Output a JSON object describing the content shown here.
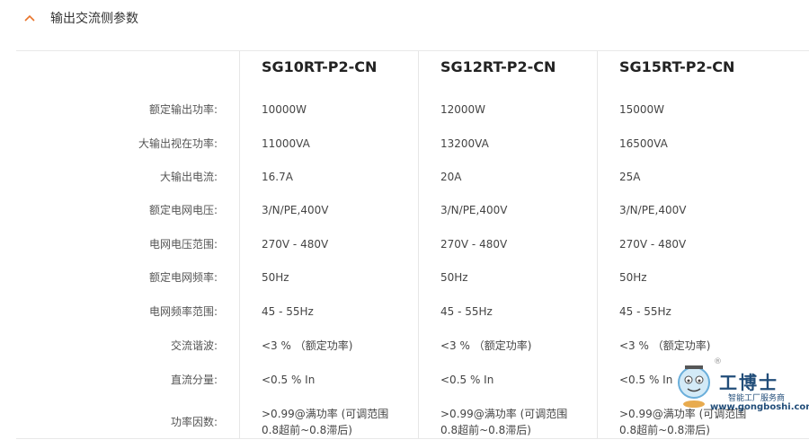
{
  "section": {
    "title": "输出交流侧参数",
    "toggle_icon": "chevron-up-icon",
    "accent": "#e8732a"
  },
  "table": {
    "models": [
      "SG10RT-P2-CN",
      "SG12RT-P2-CN",
      "SG15RT-P2-CN"
    ],
    "rows": [
      {
        "label": "额定输出功率:",
        "values": [
          "10000W",
          "12000W",
          "15000W"
        ]
      },
      {
        "label": "大输出视在功率:",
        "values": [
          "11000VA",
          "13200VA",
          "16500VA"
        ]
      },
      {
        "label": "大输出电流:",
        "values": [
          "16.7A",
          "20A",
          "25A"
        ]
      },
      {
        "label": "额定电网电压:",
        "values": [
          "3/N/PE,400V",
          "3/N/PE,400V",
          "3/N/PE,400V"
        ]
      },
      {
        "label": "电网电压范围:",
        "values": [
          "270V - 480V",
          "270V - 480V",
          "270V - 480V"
        ]
      },
      {
        "label": "额定电网频率:",
        "values": [
          "50Hz",
          "50Hz",
          "50Hz"
        ]
      },
      {
        "label": "电网频率范围:",
        "values": [
          "45 - 55Hz",
          "45 - 55Hz",
          "45 - 55Hz"
        ]
      },
      {
        "label": "交流谐波:",
        "values": [
          "<3 % （额定功率)",
          "<3 % （额定功率)",
          "<3 % （额定功率)"
        ]
      },
      {
        "label": "直流分量:",
        "values": [
          "<0.5 % In",
          "<0.5 % In",
          "<0.5 % In"
        ]
      },
      {
        "label": "功率因数:",
        "values": [
          ">0.99@满功率 (可调范围\n0.8超前~0.8滞后)",
          ">0.99@满功率 (可调范围\n0.8超前~0.8滞后)",
          ">0.99@满功率 (可调范围\n0.8超前~0.8滞后)"
        ]
      }
    ]
  },
  "watermark": {
    "brand": "工博士",
    "tagline": "智能工厂服务商",
    "url": "www.gongboshi.com",
    "registered": "®"
  }
}
